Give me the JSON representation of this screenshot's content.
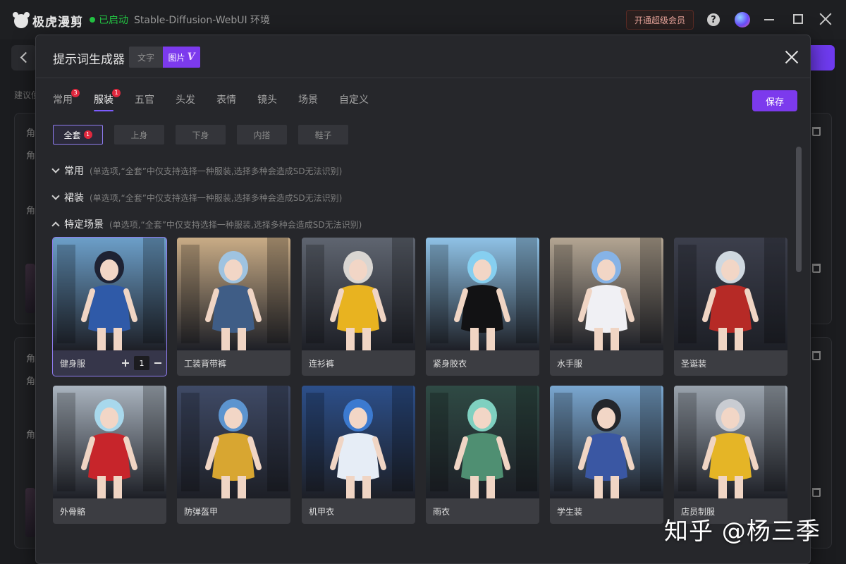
{
  "app": {
    "name": "极虎漫剪",
    "status": "已启动",
    "environment": "Stable-Diffusion-WebUI 环境",
    "vip_button": "开通超级会员",
    "help": "?"
  },
  "background": {
    "hint": "建议使",
    "labels": [
      "角",
      "角",
      "角",
      "角",
      "角",
      "角"
    ]
  },
  "modal": {
    "title": "提示词生成器",
    "mode_text": "文字",
    "mode_image": "图片",
    "mode_image_badge": "V",
    "save": "保存"
  },
  "tabs": [
    {
      "label": "常用",
      "badge": "3"
    },
    {
      "label": "服装",
      "badge": "1"
    },
    {
      "label": "五官",
      "badge": ""
    },
    {
      "label": "头发",
      "badge": ""
    },
    {
      "label": "表情",
      "badge": ""
    },
    {
      "label": "镜头",
      "badge": ""
    },
    {
      "label": "场景",
      "badge": ""
    },
    {
      "label": "自定义",
      "badge": ""
    }
  ],
  "subtabs": [
    {
      "label": "全套",
      "badge": "1"
    },
    {
      "label": "上身",
      "badge": ""
    },
    {
      "label": "下身",
      "badge": ""
    },
    {
      "label": "内搭",
      "badge": ""
    },
    {
      "label": "鞋子",
      "badge": ""
    }
  ],
  "sections": [
    {
      "title": "常用",
      "note": "(单选项,“全套”中仅支持选择一种服装,选择多种会造成SD无法识别)"
    },
    {
      "title": "裙装",
      "note": "(单选项,“全套”中仅支持选择一种服装,选择多种会造成SD无法识别)"
    },
    {
      "title": "特定场景",
      "note": "(单选项,“全套”中仅支持选择一种服装,选择多种会造成SD无法识别)"
    }
  ],
  "cards": [
    {
      "label": "健身服",
      "selected": true,
      "quantity": "1",
      "colors": {
        "bg": "#6c9fc9",
        "hair": "#1e2233",
        "outfit": "#2f5aa8"
      }
    },
    {
      "label": "工装背带裤",
      "colors": {
        "bg": "#c9ac86",
        "hair": "#9fc3e0",
        "outfit": "#3f5d86"
      }
    },
    {
      "label": "连衫裤",
      "colors": {
        "bg": "#5f6570",
        "hair": "#d9d6d2",
        "outfit": "#e8b320"
      }
    },
    {
      "label": "紧身胶衣",
      "colors": {
        "bg": "#8fc2e6",
        "hair": "#86cff0",
        "outfit": "#121214"
      }
    },
    {
      "label": "水手服",
      "colors": {
        "bg": "#b3a592",
        "hair": "#86b3e6",
        "outfit": "#f0f0f4"
      }
    },
    {
      "label": "圣诞装",
      "colors": {
        "bg": "#3c3f4c",
        "hair": "#cfd8e0",
        "outfit": "#b62a26"
      }
    },
    {
      "label": "外骨骼",
      "colors": {
        "bg": "#aab4bf",
        "hair": "#a8d8ec",
        "outfit": "#c7252b"
      }
    },
    {
      "label": "防弹盔甲",
      "colors": {
        "bg": "#3f4a66",
        "hair": "#5c94cf",
        "outfit": "#d8a631"
      }
    },
    {
      "label": "机甲衣",
      "colors": {
        "bg": "#2c4f8a",
        "hair": "#3c7ad0",
        "outfit": "#e6edf6"
      }
    },
    {
      "label": "雨衣",
      "colors": {
        "bg": "#2f4a44",
        "hair": "#7fd0c0",
        "outfit": "#4f8f72"
      }
    },
    {
      "label": "学生装",
      "colors": {
        "bg": "#7aa7d0",
        "hair": "#24262b",
        "outfit": "#3a57a3"
      }
    },
    {
      "label": "店员制服",
      "colors": {
        "bg": "#9aa3ad",
        "hair": "#c9ccd2",
        "outfit": "#e5b526"
      }
    }
  ],
  "watermark": "知乎 @杨三季"
}
